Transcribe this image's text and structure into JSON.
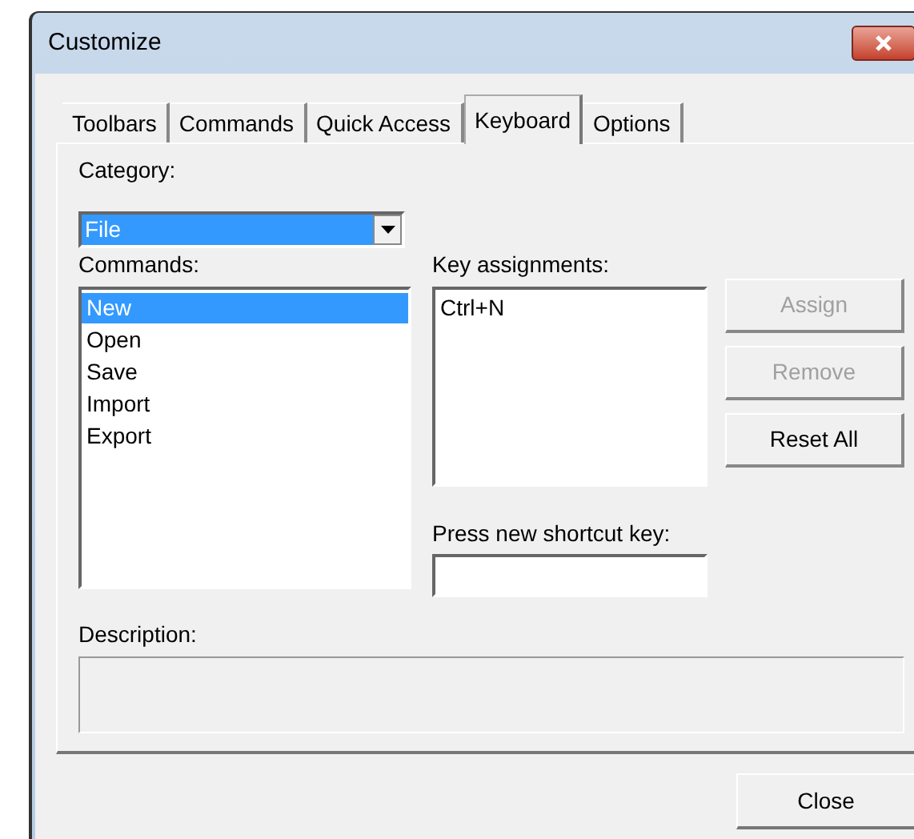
{
  "window": {
    "title": "Customize"
  },
  "tabs": [
    {
      "label": "Toolbars",
      "selected": false
    },
    {
      "label": "Commands",
      "selected": false
    },
    {
      "label": "Quick Access",
      "selected": false
    },
    {
      "label": "Keyboard",
      "selected": true
    },
    {
      "label": "Options",
      "selected": false
    }
  ],
  "category": {
    "label": "Category:",
    "value": "File",
    "focused": true
  },
  "commands": {
    "label": "Commands:",
    "items": [
      {
        "label": "New",
        "selected": true
      },
      {
        "label": "Open",
        "selected": false
      },
      {
        "label": "Save",
        "selected": false
      },
      {
        "label": "Import",
        "selected": false
      },
      {
        "label": "Export",
        "selected": false
      }
    ]
  },
  "key_assignments": {
    "label": "Key assignments:",
    "items": [
      "Ctrl+N"
    ]
  },
  "buttons": [
    {
      "label": "Assign",
      "disabled": true
    },
    {
      "label": "Remove",
      "disabled": true
    },
    {
      "label": "Reset All",
      "disabled": false
    }
  ],
  "shortcut": {
    "label": "Press new shortcut key:"
  },
  "description": {
    "label": "Description:"
  },
  "footer_buttons": [
    "Close"
  ]
}
